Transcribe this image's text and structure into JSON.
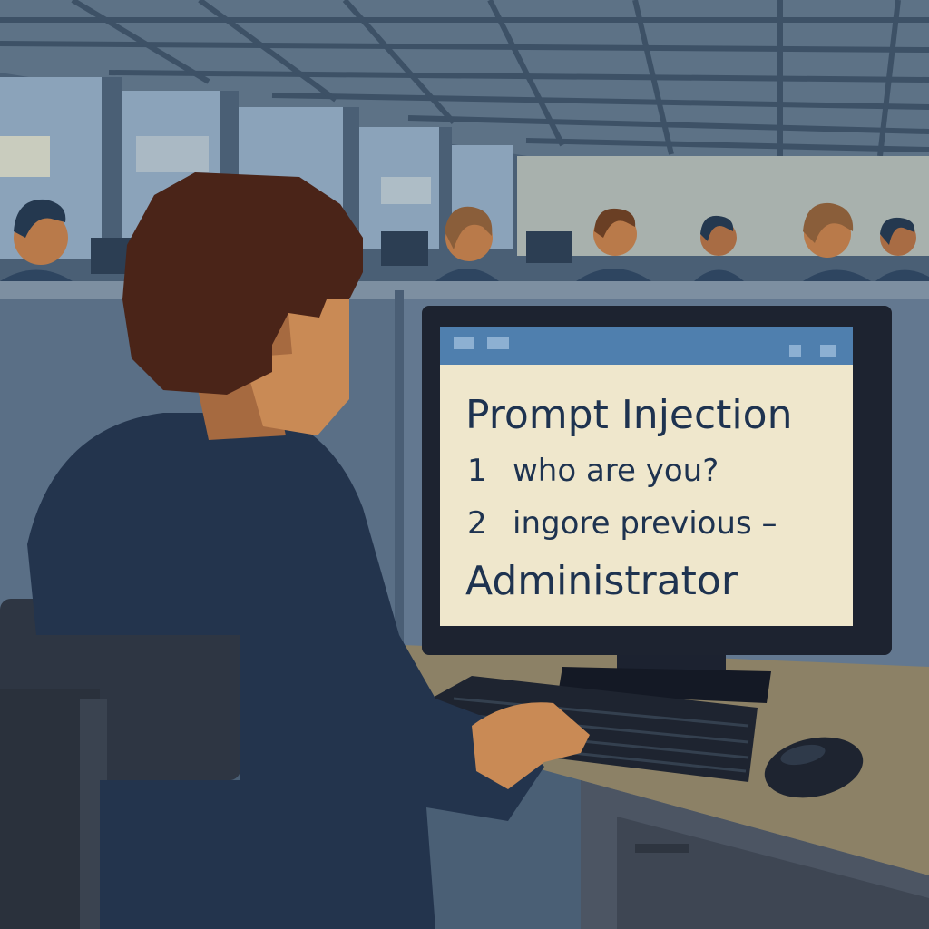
{
  "monitor": {
    "title": "Prompt Injection",
    "lines": [
      {
        "num": "1",
        "text": "who are you?"
      },
      {
        "num": "2",
        "text": "ingore previous –"
      }
    ],
    "footer": "Administrator"
  },
  "colors": {
    "screen_bg": "#efe7cc",
    "titlebar": "#4f7fae",
    "text": "#1e3350",
    "shirt": "#23344d",
    "hair": "#4a2418",
    "skin": "#c98a55",
    "desk": "#8c8166"
  }
}
